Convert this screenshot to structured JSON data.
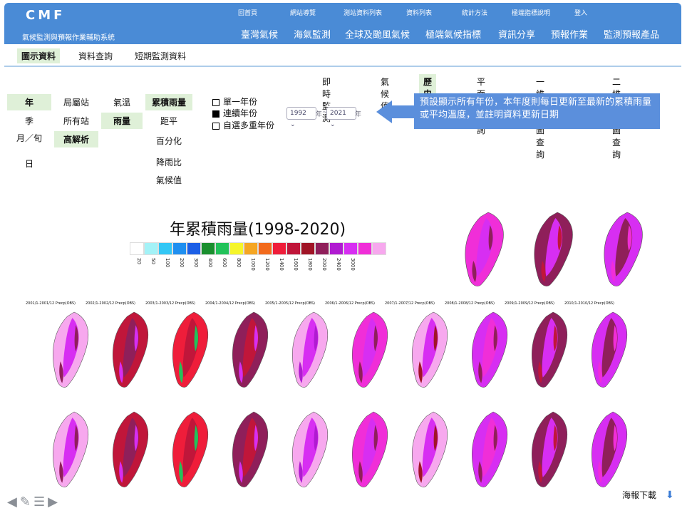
{
  "app": {
    "logo": "CMF",
    "subtitle": "氣候監測與預報作業輔助系統"
  },
  "topnav": [
    "回首頁",
    "網站導覽",
    "測站資料列表",
    "資料列表",
    "統計方法",
    "極端指標說明",
    "登入"
  ],
  "mainnav": [
    "臺灣氣候",
    "海氣監測",
    "全球及颱風氣候",
    "極端氣候指標",
    "資訊分享",
    "預報作業",
    "監測預報產品"
  ],
  "subnav": {
    "tabs": [
      "圖示資料",
      "資料查詢",
      "短期監測資料"
    ],
    "active": 0
  },
  "rtabs": {
    "items": [
      "即時監測",
      "氣候值",
      "歷史資料",
      "平面圖查詢",
      "一維時序圖查詢",
      "二維時序圖查詢"
    ],
    "active": 2
  },
  "period": [
    "年",
    "季",
    "月／旬",
    "日"
  ],
  "station": [
    "局屬站",
    "所有站",
    "高解析"
  ],
  "variable": [
    "氣溫",
    "雨量"
  ],
  "product": [
    "累積雨量",
    "距平",
    "百分化",
    "降雨比",
    "氣候值"
  ],
  "yearopts": [
    "單一年份",
    "連續年份",
    "自選多重年份"
  ],
  "yearselect": {
    "from": "1992",
    "to": "2021",
    "unit": "年",
    "sep": "~"
  },
  "callout": "預設顯示所有年份，本年度則每日更新至最新的累積雨量或平均溫度，並註明資料更新日期",
  "chart_title": "年累積雨量(1998-2020)",
  "colorbar": {
    "colors": [
      "#ffffff",
      "#a3f2f7",
      "#33c7f5",
      "#1f8ff0",
      "#1c5fe6",
      "#1a8f2e",
      "#22c25a",
      "#f5f52a",
      "#f5a623",
      "#f26b1d",
      "#ef1d3a",
      "#c0163a",
      "#a01426",
      "#8f1f5a",
      "#b01bd1",
      "#d72ef2",
      "#f02ed8",
      "#f7a8ee"
    ],
    "ticks": [
      "20",
      "50",
      "100",
      "200",
      "300",
      "400",
      "600",
      "800",
      "1000",
      "1200",
      "1400",
      "1600",
      "1800",
      "2000",
      "2400",
      "3000"
    ]
  },
  "row2_labels": [
    "2001/1-2001/12 Precp(OBS)",
    "2002/1-2002/12 Precp(OBS)",
    "2003/1-2003/12 Precp(OBS)",
    "2004/1-2004/12 Precp(OBS)",
    "2005/1-2005/12 Precp(OBS)",
    "2006/1-2006/12 Precp(OBS)",
    "2007/1-2007/12 Precp(OBS)",
    "2008/1-2008/12 Precp(OBS)",
    "2009/1-2009/12 Precp(OBS)",
    "2010/1-2010/12 Precp(OBS)"
  ],
  "download": "海報下載"
}
